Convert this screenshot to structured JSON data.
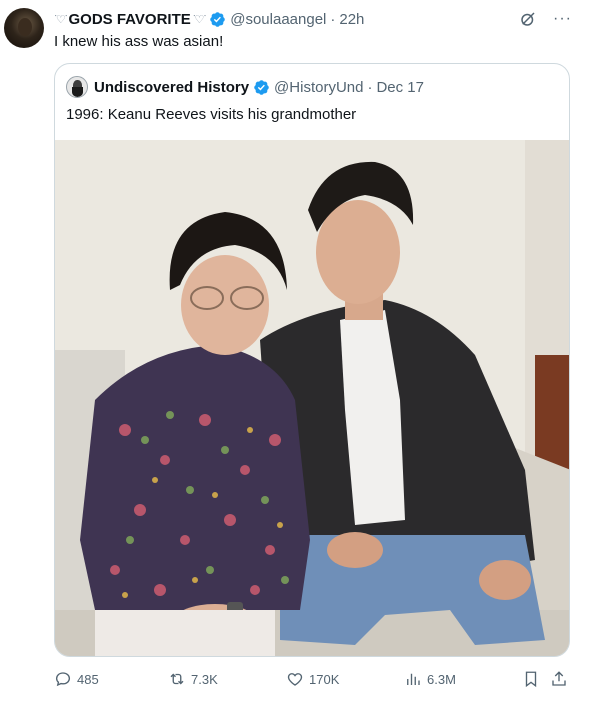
{
  "tweet": {
    "display_name": "GODS FAVORITE",
    "name_deco_left": "ᐝ♡ᐝ",
    "name_deco_right": "ᐝ♡ᐝ",
    "handle": "@soulaaangel",
    "separator": "·",
    "time": "22h",
    "text": "I knew his ass was asian!"
  },
  "quoted": {
    "display_name": "Undiscovered History",
    "handle": "@HistoryUnd",
    "separator": "·",
    "date": "Dec 17",
    "text": "1996: Keanu Reeves visits his grandmother"
  },
  "actions": {
    "replies": "485",
    "reposts": "7.3K",
    "likes": "170K",
    "views": "6.3M"
  },
  "colors": {
    "verified": "#1d9bf0",
    "muted": "#536471",
    "border": "#cfd9de"
  },
  "icons": [
    "grok-icon",
    "more-icon",
    "verified-icon",
    "reply-icon",
    "repost-icon",
    "like-icon",
    "views-icon",
    "bookmark-icon",
    "share-icon"
  ]
}
